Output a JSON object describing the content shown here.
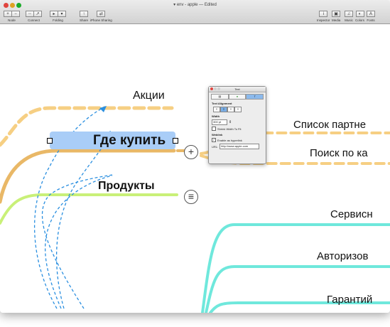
{
  "window": {
    "title": "▾ env - apple — Edited",
    "colors": {
      "close": "#e0443e",
      "minimize": "#dea123",
      "zoom": "#1aab29"
    }
  },
  "toolbar": {
    "left": [
      {
        "label": "Node",
        "buttons": [
          "+",
          "−"
        ]
      },
      {
        "label": "Connect",
        "buttons": [
          "◦◦",
          "↗"
        ]
      },
      {
        "label": "Folding",
        "buttons": [
          "▸",
          "▾"
        ]
      },
      {
        "label": "Share",
        "buttons": [
          "↑"
        ]
      },
      {
        "label": "iPhone Sharing",
        "buttons": [
          "⇄"
        ]
      }
    ],
    "right": [
      {
        "label": "Inspector",
        "icon": "i"
      },
      {
        "label": "Media",
        "icon": "▣"
      },
      {
        "label": "Music",
        "icon": "♫"
      },
      {
        "label": "Colors",
        "icon": "◐"
      },
      {
        "label": "Fonts",
        "icon": "A"
      }
    ]
  },
  "nodes": {
    "akcii": "Акции",
    "gde_kupit": "Где купить",
    "produkty": "Продукты",
    "spisok": "Список партне",
    "poisk": "Поиск по ка",
    "servis": "Сервисн",
    "avtoriz": "Авторизов",
    "garant": "Гарантий"
  },
  "node_buttons": {
    "add": "+",
    "menu": "≡"
  },
  "inspector": {
    "title": "Text",
    "tabs": [
      "▤",
      "●",
      "T"
    ],
    "text_alignment_label": "Text Alignment",
    "align_buttons": [
      "≡",
      "≡",
      "≡",
      "≡"
    ],
    "width_label": "Width",
    "width_value": "300 pt",
    "shrink_label": "Shrink Width To Fit",
    "weblink_label": "Weblink",
    "enable_label": "Enable as hyperlink",
    "url_label": "URL:",
    "url_value": "http://www.apple.com"
  },
  "line_colors": {
    "orange": "#e9b867",
    "orange_dashed": "#f6cf83",
    "lime": "#c9f078",
    "cyan": "#6fe8dc",
    "blue_dashed": "#2a8fe0"
  }
}
